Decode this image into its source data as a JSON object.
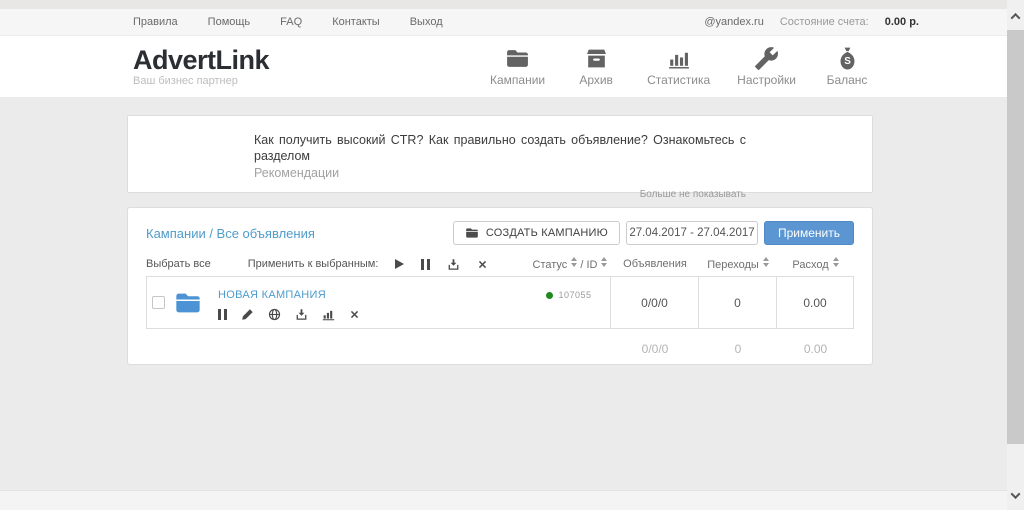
{
  "topbar": {
    "links": [
      "Правила",
      "Помощь",
      "FAQ",
      "Контакты",
      "Выход"
    ],
    "email": "@yandex.ru",
    "balance_label": "Состояние счета:",
    "balance_value": "0.00 р."
  },
  "header": {
    "logo": "AdvertLink",
    "tagline": "Ваш бизнес партнер",
    "nav": [
      {
        "label": "Кампании",
        "icon": "folder-icon"
      },
      {
        "label": "Архив",
        "icon": "archive-box-icon"
      },
      {
        "label": "Статистика",
        "icon": "bar-chart-icon"
      },
      {
        "label": "Настройки",
        "icon": "wrench-icon"
      },
      {
        "label": "Баланс",
        "icon": "money-bag-icon"
      }
    ]
  },
  "notice": {
    "text": "Как получить высокий CTR? Как правильно создать объявление? Ознакомьтесь с разделом",
    "link": "Рекомендации",
    "dismiss": "Больше не показывать"
  },
  "panel": {
    "breadcrumb": "Кампании / Все объявления",
    "create_button": "СОЗДАТЬ КАМПАНИЮ",
    "date_range": "27.04.2017 - 27.04.2017",
    "apply_button": "Применить",
    "select_all": "Выбрать все",
    "apply_selected": "Применить к выбранным:",
    "bulk_action_icons": [
      "play-icon",
      "pause-icon",
      "download-icon",
      "delete-x-icon"
    ],
    "columns": {
      "status": "Статус",
      "separator": "/",
      "id": "ID",
      "ads": "Объявления",
      "clicks": "Переходы",
      "spend": "Расход"
    },
    "campaign": {
      "name": "НОВАЯ КАМПАНИЯ",
      "id": "107055",
      "status_color": "#1f8a1f",
      "action_icons": [
        "pause-icon",
        "edit-pencil-icon",
        "globe-icon",
        "download-icon",
        "stats-icon",
        "delete-x-icon"
      ],
      "ads": "0/0/0",
      "clicks": "0",
      "spend": "0.00"
    },
    "totals": {
      "ads": "0/0/0",
      "clicks": "0",
      "spend": "0.00"
    }
  },
  "colors": {
    "accent_blue": "#5b96d2",
    "link_blue": "#4e9ccc",
    "status_green": "#1f8a1f",
    "page_bg": "#ebebeb"
  }
}
